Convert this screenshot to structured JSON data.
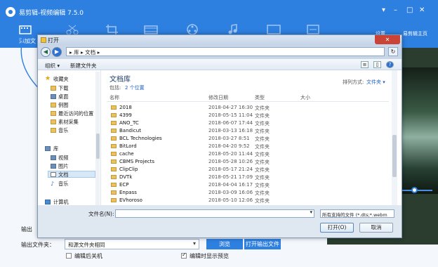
{
  "app": {
    "title": "易剪辑-视频编辑 7.5.0",
    "add_file_label": "添加文",
    "settings_label": "设置",
    "home_label": "易剪辑主页",
    "output_label_1": "输出",
    "output_folder_label": "输出文件夹：",
    "output_folder_value": "和源文件夹相同",
    "browse_label": "浏览",
    "open_output_label": "打开输出文件",
    "edit_after_label": "编辑后关机",
    "preview_while_label": "编辑时显示预览",
    "edit_after_checked": false,
    "preview_while_checked": true,
    "accent_color": "#2d7fe0"
  },
  "dialog": {
    "title": "打开",
    "address": "▸ 库 ▸ 文档 ▸",
    "organize": "组织 ▾",
    "new_folder": "新建文件夹",
    "nav": {
      "favorites": "收藏夹",
      "download": "下载",
      "desktop": "桌面",
      "examples": "例图",
      "recent": "最近访问的位置",
      "material": "素材采集",
      "music1": "音乐",
      "library": "库",
      "video": "视频",
      "pictures": "图片",
      "documents": "文档",
      "music2": "音乐",
      "computer": "计算机"
    },
    "library_title": "文档库",
    "library_subtitle_a": "包括:",
    "library_subtitle_b": "2 个位置",
    "arrange_label": "排列方式:",
    "arrange_value": "文件夹 ▾",
    "columns": {
      "name": "名称",
      "date": "修改日期",
      "type": "类型",
      "size": "大小"
    },
    "files": [
      {
        "name": "2018",
        "date": "2018-04-27 16:30",
        "type": "文件夹"
      },
      {
        "name": "4399",
        "date": "2018-05-15 11:04",
        "type": "文件夹"
      },
      {
        "name": "ANO_TC",
        "date": "2018-06-07 17:44",
        "type": "文件夹"
      },
      {
        "name": "Bandicut",
        "date": "2018-03-13 16:18",
        "type": "文件夹"
      },
      {
        "name": "BCL Technologies",
        "date": "2018-03-27 8:51",
        "type": "文件夹"
      },
      {
        "name": "BitLord",
        "date": "2018-04-20 9:52",
        "type": "文件夹"
      },
      {
        "name": "cache",
        "date": "2018-05-20 11:44",
        "type": "文件夹"
      },
      {
        "name": "CBMS Projects",
        "date": "2018-05-28 10:26",
        "type": "文件夹"
      },
      {
        "name": "ClipClip",
        "date": "2018-05-17 21:24",
        "type": "文件夹"
      },
      {
        "name": "DVTk",
        "date": "2018-05-21 17:09",
        "type": "文件夹"
      },
      {
        "name": "ECP",
        "date": "2018-04-04 16:17",
        "type": "文件夹"
      },
      {
        "name": "Enpass",
        "date": "2018-03-09 16:06",
        "type": "文件夹"
      },
      {
        "name": "EVhoroso",
        "date": "2018-05-10 12:06",
        "type": "文件夹"
      }
    ],
    "filename_label": "文件名(N):",
    "filetype_value": "所有支持的文件 (*.dts;*.webm",
    "open_label": "打开(O)",
    "cancel_label": "取消"
  }
}
